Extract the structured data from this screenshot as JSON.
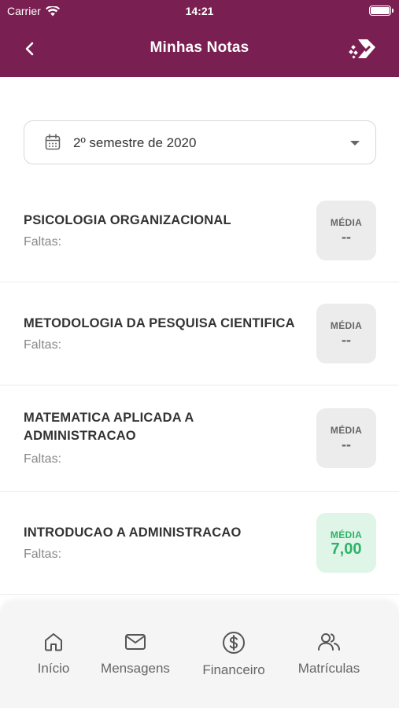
{
  "status_bar": {
    "carrier": "Carrier",
    "time": "14:21"
  },
  "header": {
    "title": "Minhas Notas"
  },
  "semester_selector": {
    "value": "2º semestre de 2020"
  },
  "disciplines": [
    {
      "name": "PSICOLOGIA ORGANIZACIONAL",
      "absences_label": "Faltas:",
      "grade_label": "MÉDIA",
      "grade": "--"
    },
    {
      "name": "METODOLOGIA DA PESQUISA CIENTIFICA",
      "absences_label": "Faltas:",
      "grade_label": "MÉDIA",
      "grade": "--"
    },
    {
      "name": "MATEMATICA APLICADA A ADMINISTRACAO",
      "absences_label": "Faltas:",
      "grade_label": "MÉDIA",
      "grade": "--"
    },
    {
      "name": "INTRODUCAO A ADMINISTRACAO",
      "absences_label": "Faltas:",
      "grade_label": "MÉDIA",
      "grade": "7,00"
    }
  ],
  "tab_bar": {
    "items": [
      {
        "label": "Início",
        "icon": "home-icon"
      },
      {
        "label": "Mensagens",
        "icon": "mail-icon"
      },
      {
        "label": "Financeiro",
        "icon": "dollar-icon"
      },
      {
        "label": "Matrículas",
        "icon": "users-icon"
      }
    ]
  },
  "colors": {
    "brand": "#7a1f51",
    "grade_pending_bg": "#ececec",
    "grade_pass_bg": "#def5e7",
    "grade_pass_text": "#2db369"
  }
}
